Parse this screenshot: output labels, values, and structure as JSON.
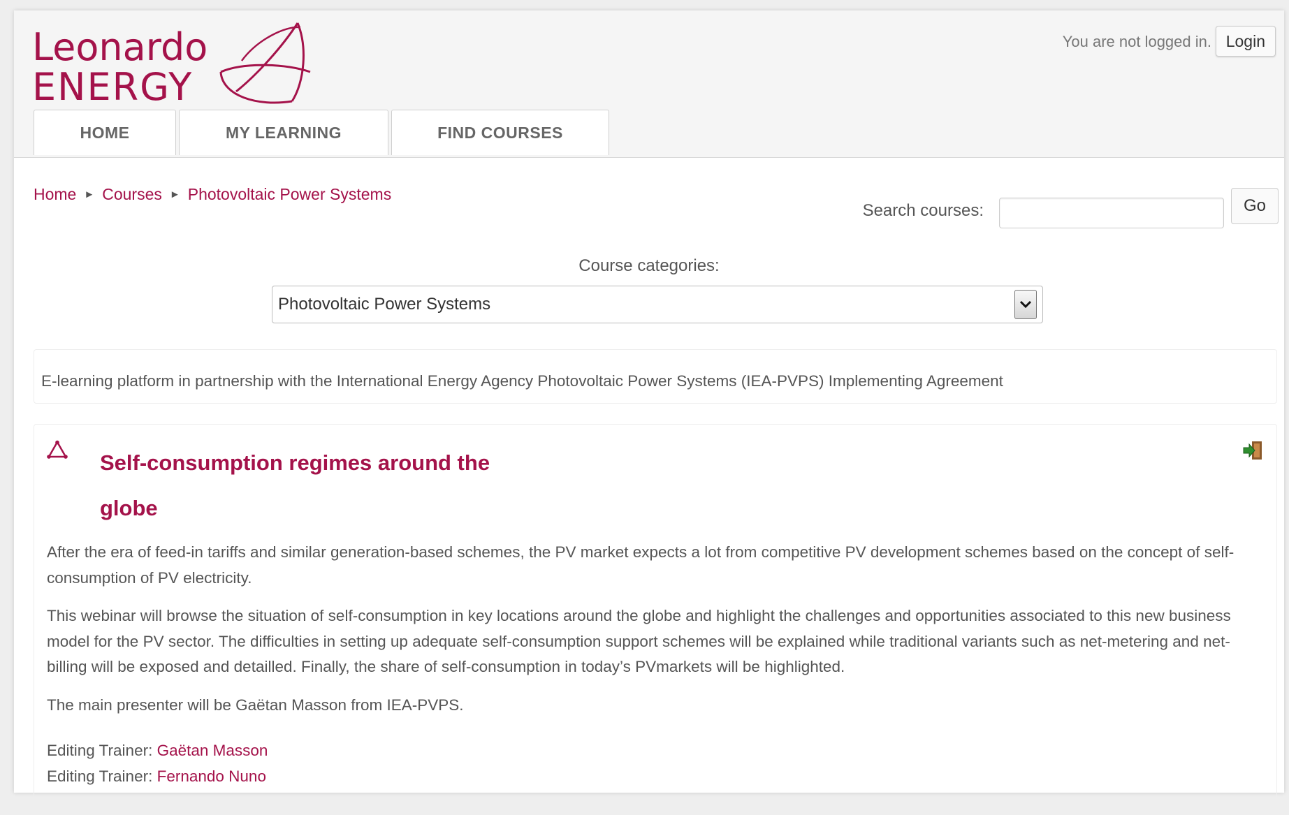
{
  "logo": {
    "line1": "Leonardo",
    "line2": "ENERGY"
  },
  "header": {
    "login_info": "You are not logged in.",
    "login_label": "Login"
  },
  "nav": {
    "tabs": [
      {
        "label": "HOME"
      },
      {
        "label": "MY LEARNING"
      },
      {
        "label": "FIND COURSES"
      }
    ]
  },
  "breadcrumb": {
    "items": [
      "Home",
      "Courses",
      "Photovoltaic Power Systems"
    ],
    "separator": "►"
  },
  "search": {
    "label": "Search courses:",
    "value": "",
    "placeholder": "",
    "button_label": "Go"
  },
  "categories": {
    "label": "Course categories:",
    "selected": "Photovoltaic Power Systems"
  },
  "category_description": "E-learning platform in partnership with the International Energy Agency Photovoltaic Power Systems (IEA-PVPS) Implementing Agreement",
  "course": {
    "title_line1": "Self-consumption regimes around the",
    "title_line2": "globe",
    "paragraphs": [
      "After the era of feed-in tariffs and similar generation-based schemes, the PV market expects a lot from competitive PV development schemes based on the concept of self-consumption of PV electricity.",
      "This webinar will browse the situation of self-consumption in key locations around the globe and highlight the challenges and opportunities associated to this new business model for the PV sector. The difficulties in setting up adequate self-consumption support schemes will be explained while traditional variants such as net-metering and net-billing will be exposed and detailled. Finally, the share of self-consumption in today’s PVmarkets will be highlighted.",
      "The main presenter will be Gaëtan Masson from IEA-PVPS."
    ],
    "trainers": [
      {
        "role": "Editing Trainer:",
        "name": "Gaëtan Masson"
      },
      {
        "role": "Editing Trainer:",
        "name": "Fernando Nuno"
      }
    ]
  },
  "colors": {
    "brand": "#a4124a",
    "text": "#555555",
    "header_bg": "#f5f5f5"
  },
  "icons": [
    "leonardo-energy-logo-mark",
    "course-icon",
    "enrol-icon",
    "dropdown-arrow-icon"
  ]
}
